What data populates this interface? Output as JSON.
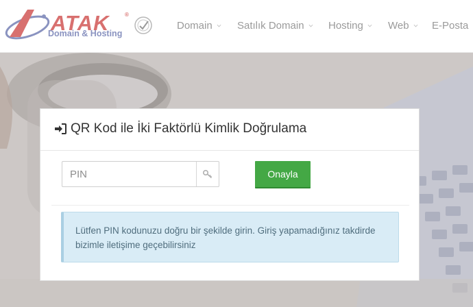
{
  "brand": {
    "name": "ATAK",
    "registered_mark": "®",
    "tagline": "Domain & Hosting"
  },
  "nav": {
    "items": [
      {
        "label": "Domain"
      },
      {
        "label": "Satılık Domain"
      },
      {
        "label": "Hosting"
      },
      {
        "label": "Web"
      },
      {
        "label": "E-Posta"
      }
    ]
  },
  "card": {
    "title": "QR Kod ile İki Faktörlü Kimlik Doğrulama",
    "title_icon": "sign-in-icon",
    "pin_input": {
      "value": "",
      "placeholder": "PIN",
      "addon_icon": "key-icon"
    },
    "submit_label": "Onayla",
    "info_message": "Lütfen PIN kodunuzu doğru bir şekilde girin. Giriş yapamadığınız takdirde bizimle iletişime geçebilirsiniz"
  },
  "colors": {
    "brand_red": "#d8706f",
    "brand_blue": "#8a93c0",
    "button_green": "#44a845",
    "info_bg": "#d9ecf6",
    "info_text": "#4f6d7d"
  }
}
